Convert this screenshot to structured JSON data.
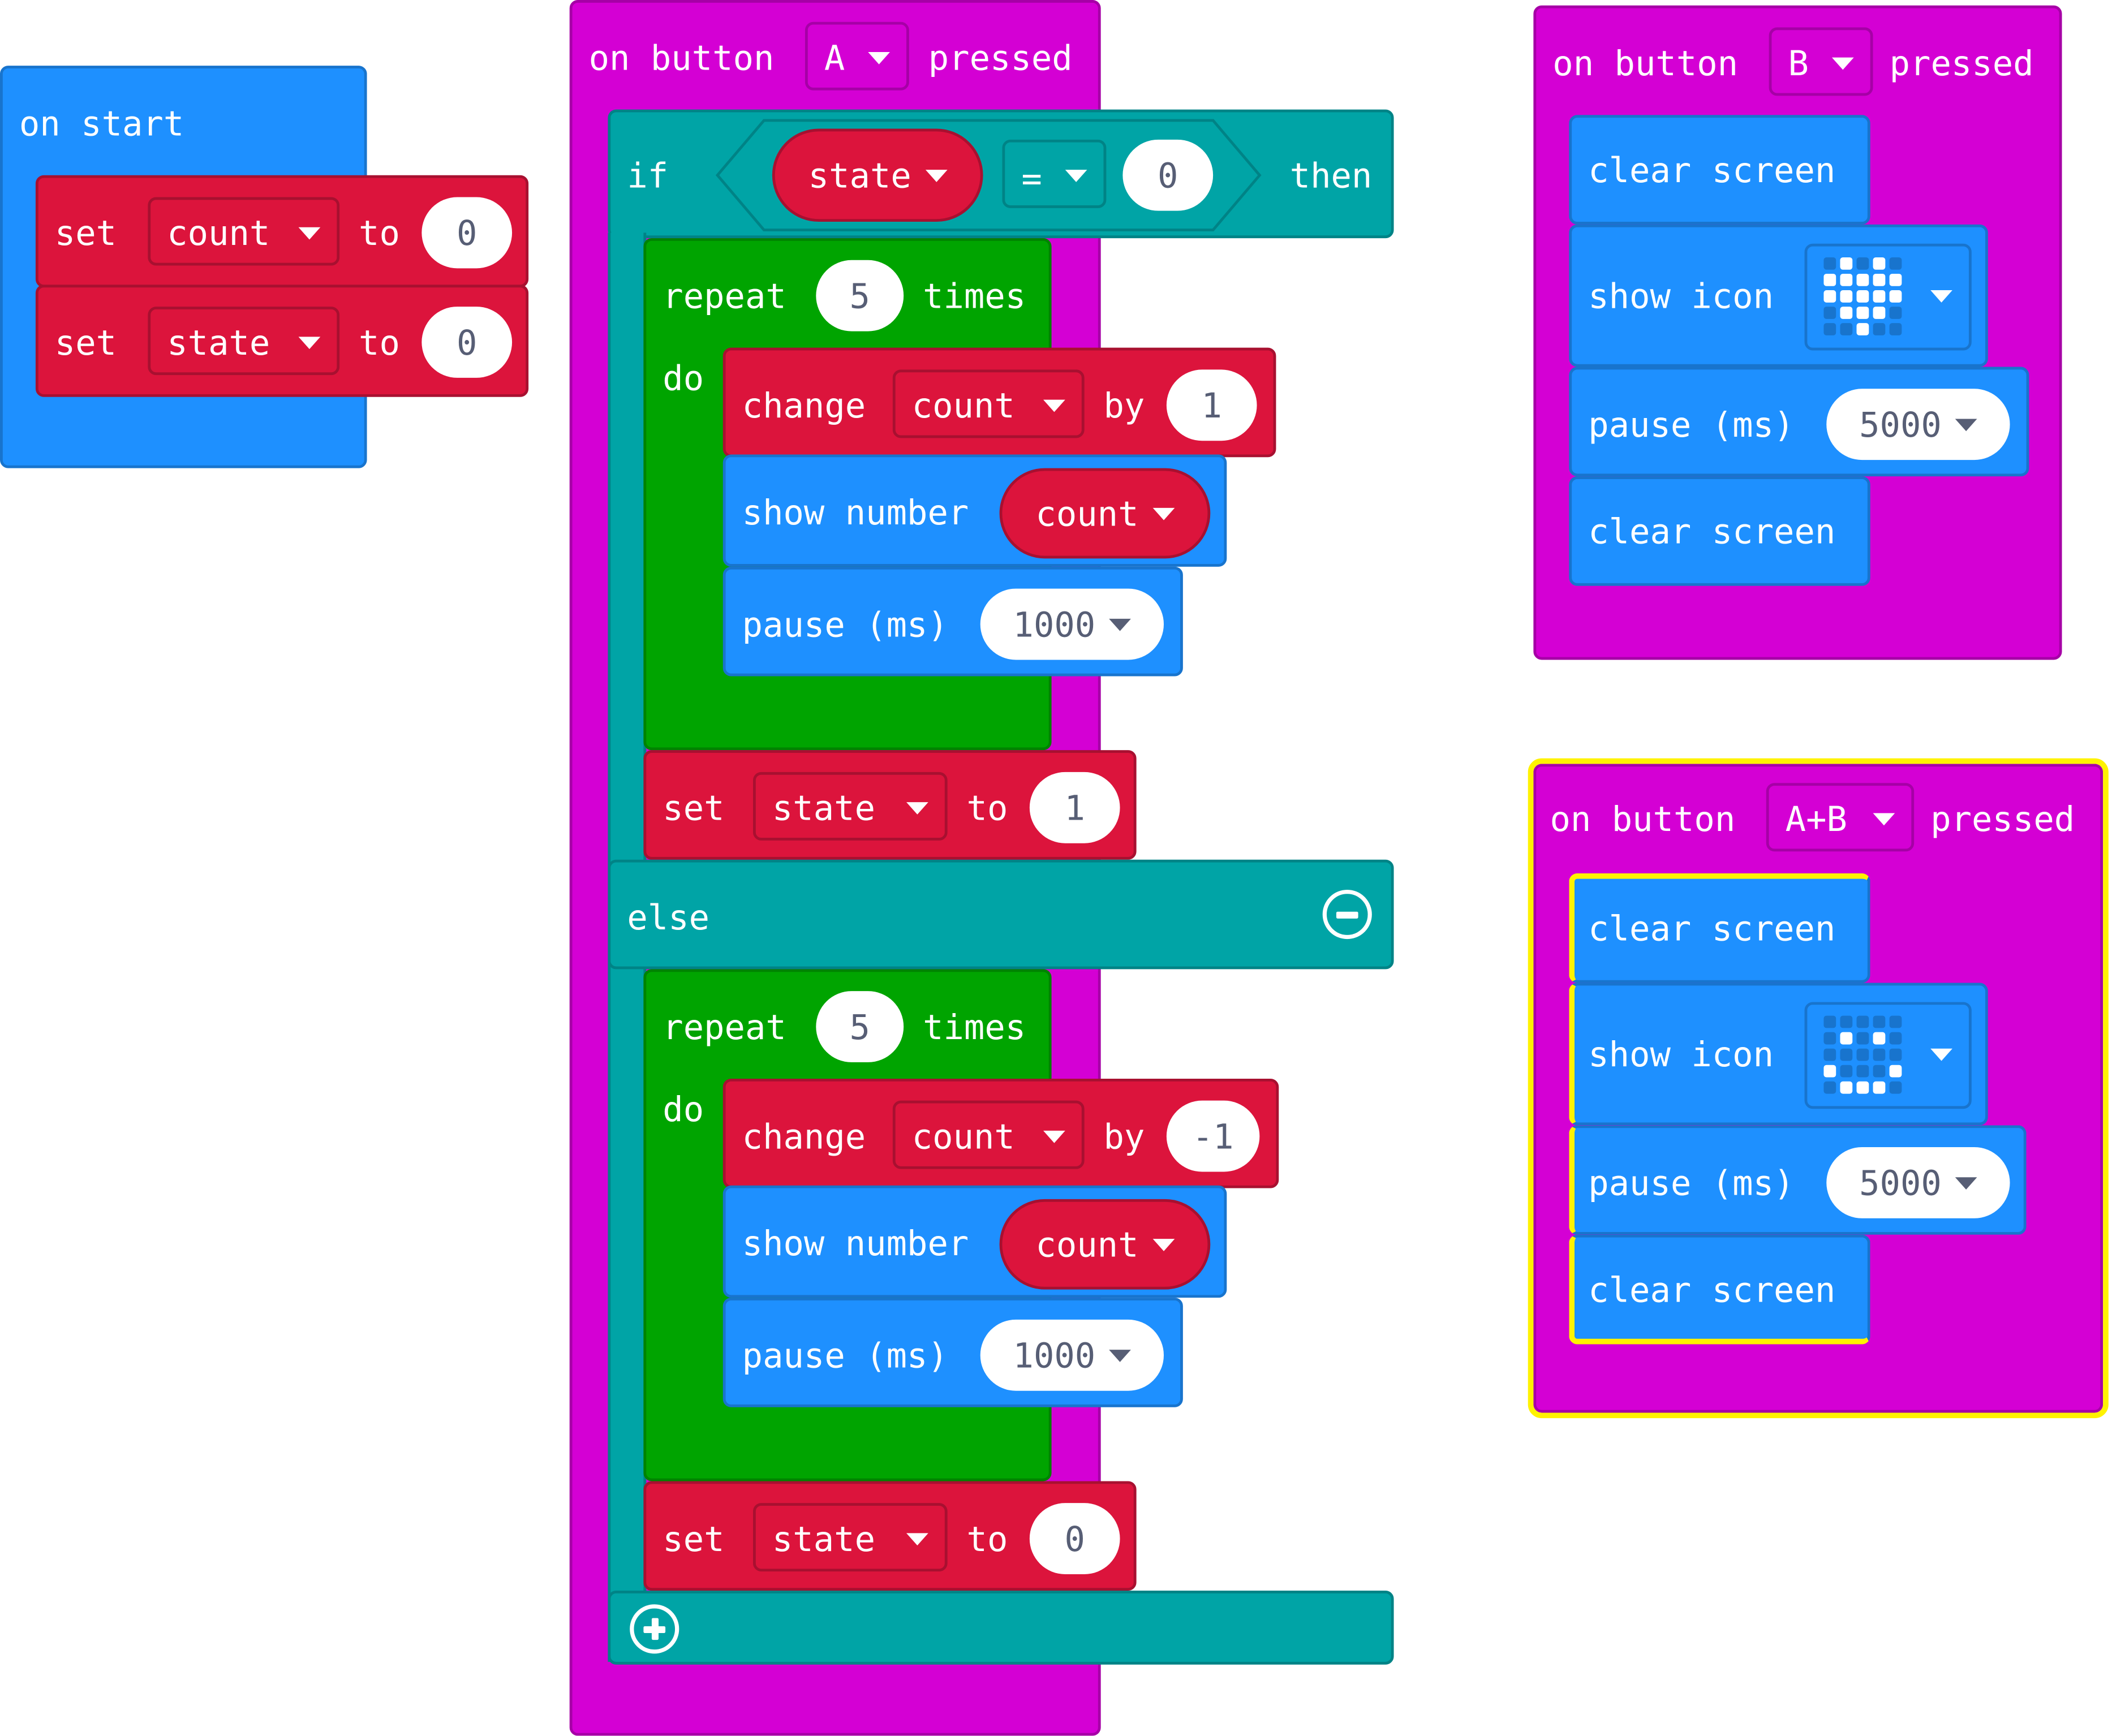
{
  "colors": {
    "basic": "#1e90ff",
    "variables": "#dc143c",
    "input": "#d400d4",
    "logic": "#00a4a6",
    "loops": "#00a400",
    "selection_highlight": "#fff200"
  },
  "on_start": {
    "label": "on start",
    "statements": [
      {
        "kw": "set",
        "var": "count",
        "to": "to",
        "value": "0"
      },
      {
        "kw": "set",
        "var": "state",
        "to": "to",
        "value": "0"
      }
    ]
  },
  "button_a": {
    "label_on": "on button",
    "button": "A",
    "label_pressed": "pressed",
    "if_kw": "if",
    "cond_var": "state",
    "cond_op": "=",
    "cond_value": "0",
    "then_kw": "then",
    "then_repeat": {
      "kw": "repeat",
      "times_value": "5",
      "times_kw": "times",
      "do_kw": "do"
    },
    "then_change": {
      "kw": "change",
      "var": "count",
      "by": "by",
      "value": "1"
    },
    "then_show": {
      "kw": "show number",
      "var": "count"
    },
    "then_pause": {
      "kw": "pause (ms)",
      "value": "1000"
    },
    "then_set": {
      "kw": "set",
      "var": "state",
      "to": "to",
      "value": "1"
    },
    "else_kw": "else",
    "else_repeat": {
      "kw": "repeat",
      "times_value": "5",
      "times_kw": "times",
      "do_kw": "do"
    },
    "else_change": {
      "kw": "change",
      "var": "count",
      "by": "by",
      "value": "-1"
    },
    "else_show": {
      "kw": "show number",
      "var": "count"
    },
    "else_pause": {
      "kw": "pause (ms)",
      "value": "1000"
    },
    "else_set": {
      "kw": "set",
      "var": "state",
      "to": "to",
      "value": "0"
    }
  },
  "button_b": {
    "label_on": "on button",
    "button": "B",
    "label_pressed": "pressed",
    "clear1": "clear screen",
    "show_icon": "show icon",
    "icon_name": "heart-icon",
    "icon_leds": [
      "01010",
      "11111",
      "11111",
      "01110",
      "00100"
    ],
    "pause_kw": "pause (ms)",
    "pause_value": "5000",
    "clear2": "clear screen"
  },
  "button_ab": {
    "label_on": "on button",
    "button": "A+B",
    "label_pressed": "pressed",
    "clear1": "clear screen",
    "show_icon": "show icon",
    "icon_name": "smiley-icon",
    "icon_leds": [
      "00000",
      "01010",
      "00000",
      "10001",
      "01110"
    ],
    "pause_kw": "pause (ms)",
    "pause_value": "5000",
    "clear2": "clear screen",
    "selected": true
  }
}
